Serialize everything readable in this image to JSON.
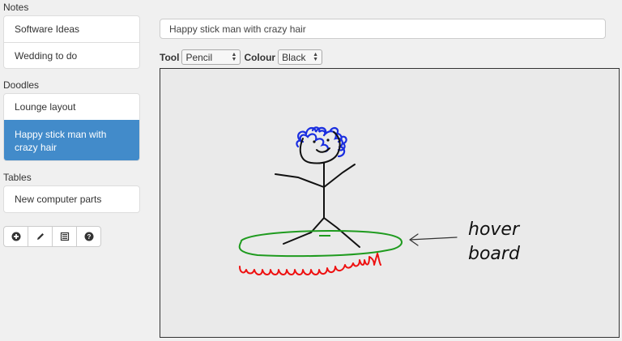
{
  "sidebar": {
    "sections": [
      {
        "title": "Notes",
        "items": [
          "Software Ideas",
          "Wedding to do"
        ]
      },
      {
        "title": "Doodles",
        "items": [
          "Lounge layout",
          "Happy stick man with crazy hair"
        ]
      },
      {
        "title": "Tables",
        "items": [
          "New computer parts"
        ]
      }
    ],
    "buttons": [
      {
        "name": "add-icon"
      },
      {
        "name": "pencil-icon"
      },
      {
        "name": "table-icon"
      },
      {
        "name": "help-icon"
      }
    ]
  },
  "main": {
    "title_value": "Happy stick man with crazy hair",
    "tool_label": "Tool",
    "tool_value": "Pencil",
    "colour_label": "Colour",
    "colour_value": "Black"
  },
  "drawing": {
    "annotation_line1": "hover",
    "annotation_line2": "board",
    "colors": {
      "ink": "#111111",
      "hair": "#1a2ee0",
      "board": "#1f9b1f",
      "flame": "#ee1111"
    }
  },
  "colors": {
    "accent": "#428bca"
  }
}
